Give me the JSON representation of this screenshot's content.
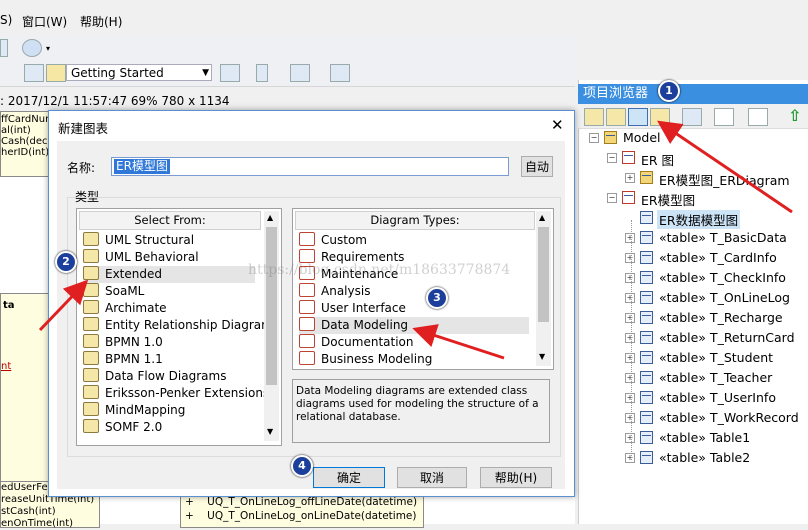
{
  "menubar": {
    "items": [
      "S)",
      "窗口(W)",
      "帮助(H)"
    ]
  },
  "toolbar2": {
    "combo_value": "Getting Started"
  },
  "infobar": {
    "text": ": 2017/12/1 11:57:47  69%  780 x 1134"
  },
  "diagram": {
    "top_fragments": [
      "ffCardNum",
      "al(int)",
      "Cash(decim",
      "herID(int)"
    ],
    "class2_fragments": [
      "ta",
      "nt"
    ],
    "bottom_fragments": [
      "edUserFee(",
      "reaseUnitTime(int)",
      "stCash(int)",
      "enOnTime(int)"
    ],
    "bottom_ops": [
      {
        "sign": "+",
        "text": "UQ_T_OnLineLog_offLineDate(datetime)"
      },
      {
        "sign": "+",
        "text": "UQ_T_OnLineLog_onLineDate(datetime)"
      }
    ]
  },
  "project_browser": {
    "title": "项目浏览器",
    "tree": [
      {
        "label": "Model",
        "level": 0,
        "icon": "model-icon"
      },
      {
        "label": "ER 图",
        "level": 1,
        "icon": "package-icon"
      },
      {
        "label": "ER模型图_ERDiagram",
        "level": 2,
        "icon": "folder-icon"
      },
      {
        "label": "ER模型图",
        "level": 1,
        "icon": "package-icon"
      },
      {
        "label": "ER数据模型图",
        "level": 2,
        "icon": "diagram-icon",
        "selected": true
      },
      {
        "label": "«table» T_BasicData",
        "level": 2,
        "icon": "table-icon"
      },
      {
        "label": "«table» T_CardInfo",
        "level": 2,
        "icon": "table-icon"
      },
      {
        "label": "«table» T_CheckInfo",
        "level": 2,
        "icon": "table-icon"
      },
      {
        "label": "«table» T_OnLineLog",
        "level": 2,
        "icon": "table-icon"
      },
      {
        "label": "«table» T_Recharge",
        "level": 2,
        "icon": "table-icon"
      },
      {
        "label": "«table» T_ReturnCard",
        "level": 2,
        "icon": "table-icon"
      },
      {
        "label": "«table» T_Student",
        "level": 2,
        "icon": "table-icon"
      },
      {
        "label": "«table» T_Teacher",
        "level": 2,
        "icon": "table-icon"
      },
      {
        "label": "«table» T_UserInfo",
        "level": 2,
        "icon": "table-icon"
      },
      {
        "label": "«table» T_WorkRecord",
        "level": 2,
        "icon": "table-icon"
      },
      {
        "label": "«table» Table1",
        "level": 2,
        "icon": "table-icon"
      },
      {
        "label": "«table» Table2",
        "level": 2,
        "icon": "table-icon"
      }
    ]
  },
  "dialog": {
    "title": "新建图表",
    "name_label": "名称:",
    "name_value": "ER模型图",
    "auto_button": "自动",
    "type_group": "类型",
    "select_from_header": "Select From:",
    "select_from": [
      "UML Structural",
      "UML Behavioral",
      "Extended",
      "SoaML",
      "Archimate",
      "Entity Relationship Diagram",
      "BPMN 1.0",
      "BPMN 1.1",
      "Data Flow Diagrams",
      "Eriksson-Penker Extensions",
      "MindMapping",
      "SOMF 2.0"
    ],
    "selected_from": "Extended",
    "diagram_types_header": "Diagram Types:",
    "diagram_types": [
      "Custom",
      "Requirements",
      "Maintenance",
      "Analysis",
      "User Interface",
      "Data Modeling",
      "Documentation",
      "Business Modeling"
    ],
    "selected_type": "Data Modeling",
    "description": "Data Modeling diagrams are extended class diagrams used for modeling the structure of a relational database.",
    "ok_button": "确定",
    "cancel_button": "取消",
    "help_button": "帮助(H)",
    "close_glyph": "✕"
  },
  "watermark": "https://blog.csdn.net/m18633778874",
  "badges": [
    "1",
    "2",
    "3",
    "4"
  ],
  "accent_colors": {
    "browser_title": "#3b8fe0",
    "badge": "#1b3f9a",
    "arrow": "#e02020",
    "selection": "#cde4f7"
  }
}
